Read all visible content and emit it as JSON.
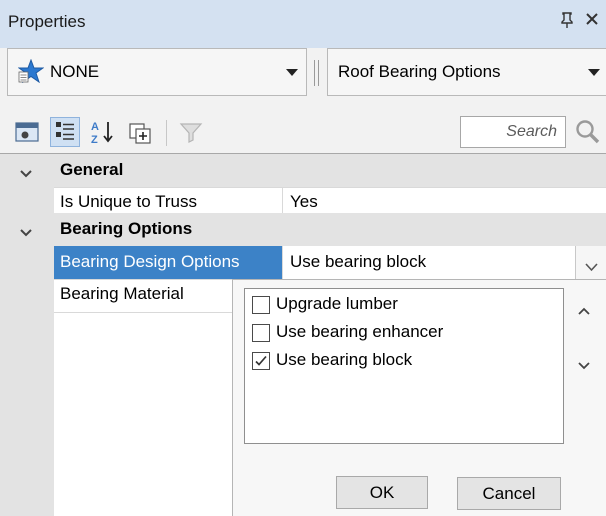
{
  "panel": {
    "title": "Properties",
    "pin_glyph": "߫",
    "close_glyph": "×"
  },
  "selector": {
    "left_value": "NONE",
    "right_value": "Roof Bearing Options"
  },
  "toolbar": {
    "search_placeholder": "Search",
    "sort_az_glyph": "A↓"
  },
  "grid": {
    "categories": [
      {
        "label": "General",
        "rows": [
          {
            "name": "Is Unique to Truss",
            "value": "Yes"
          }
        ]
      },
      {
        "label": "Bearing Options",
        "rows": [
          {
            "name": "Bearing Design Options",
            "value": "Use bearing block"
          },
          {
            "name": "Bearing Material",
            "value": ""
          }
        ]
      }
    ]
  },
  "dropdown": {
    "options": [
      {
        "label": "Upgrade lumber",
        "checked": false
      },
      {
        "label": "Use bearing enhancer",
        "checked": false
      },
      {
        "label": "Use bearing block",
        "checked": true
      }
    ],
    "ok_label": "OK",
    "cancel_label": "Cancel"
  },
  "colors": {
    "title_bar": "#d4e1f1",
    "selection": "#3c82c7",
    "category_bg": "#e3e3e3"
  }
}
